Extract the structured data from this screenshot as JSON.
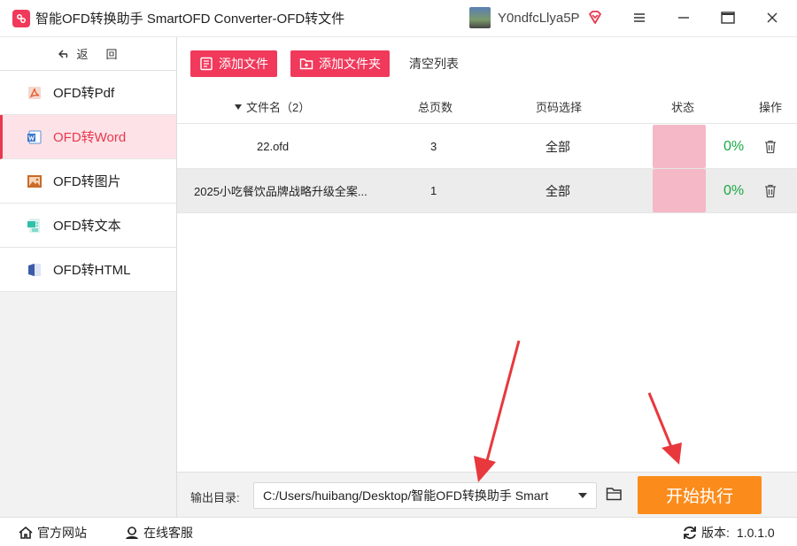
{
  "titlebar": {
    "title": "智能OFD转换助手 SmartOFD Converter-OFD转文件",
    "username": "Y0ndfcLlya5P",
    "controls": [
      "menu-icon",
      "minimize-icon",
      "maximize-icon",
      "close-icon"
    ]
  },
  "sidebar": {
    "back_label": "返",
    "back_label2": "回",
    "items": [
      {
        "label": "OFD转Pdf",
        "icon": "pdf-icon"
      },
      {
        "label": "OFD转Word",
        "icon": "word-icon",
        "active": true
      },
      {
        "label": "OFD转图片",
        "icon": "image-icon"
      },
      {
        "label": "OFD转文本",
        "icon": "text-icon"
      },
      {
        "label": "OFD转HTML",
        "icon": "html-icon"
      }
    ]
  },
  "toolbar": {
    "add_file": "添加文件",
    "add_folder": "添加文件夹",
    "clear": "清空列表"
  },
  "table": {
    "headers": {
      "name": "文件名（2）",
      "pages": "总页数",
      "page_select": "页码选择",
      "status": "状态",
      "action": "操作"
    },
    "rows": [
      {
        "name": "22.ofd",
        "pages": "3",
        "page_select": "全部",
        "progress": 0,
        "pct": "0%"
      },
      {
        "name": "2025小吃餐饮品牌战略升级全案...",
        "pages": "1",
        "page_select": "全部",
        "progress": 0,
        "pct": "0%"
      }
    ]
  },
  "output": {
    "label": "输出目录:",
    "path": "C:/Users/huibang/Desktop/智能OFD转换助手 Smart",
    "start": "开始执行"
  },
  "statusbar": {
    "website": "官方网站",
    "support": "在线客服",
    "version_label": "版本:",
    "version": "1.0.1.0"
  },
  "colors": {
    "accent": "#f0395b",
    "active_text": "#e8384f",
    "active_bg": "#fde3e7",
    "start_button": "#fb8c1c",
    "percent": "#1aa844",
    "annotation_arrow": "#e8383d"
  }
}
